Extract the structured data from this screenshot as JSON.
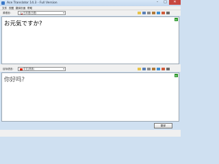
{
  "window": {
    "title": "Ace Translator 14.3 - Full Version"
  },
  "menu": [
    "文件",
    "视图",
    "翻译页面",
    "帮助"
  ],
  "source": {
    "label": "源语言:",
    "language": "日本语(日语)",
    "text": "お元気ですか?"
  },
  "target": {
    "label": "目标语言:",
    "language": "中文(简体)",
    "text": "你好吗?"
  },
  "footer": {
    "translate_label": "翻译"
  },
  "icons": {
    "toolbar": [
      "open-icon",
      "save-icon",
      "copy-icon",
      "paste-icon",
      "speak-icon",
      "clear-icon",
      "print-icon"
    ],
    "scroll": "green-arrow-icon"
  },
  "colors": {
    "accent": "#2e9a2e",
    "close": "#c7463f",
    "title_bar": "#cfe0f1"
  }
}
